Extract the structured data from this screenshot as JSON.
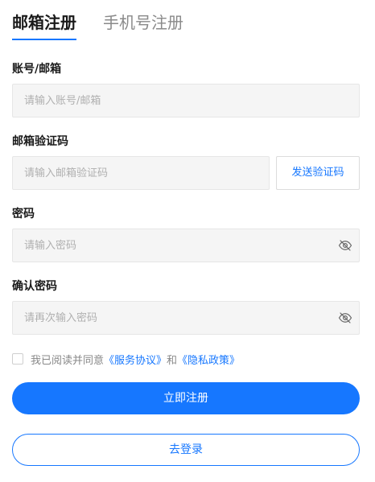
{
  "tabs": [
    {
      "label": "邮箱注册",
      "active": true
    },
    {
      "label": "手机号注册",
      "active": false
    }
  ],
  "form": {
    "account": {
      "label": "账号/邮箱",
      "placeholder": "请输入账号/邮箱",
      "value": ""
    },
    "email_code": {
      "label": "邮箱验证码",
      "placeholder": "请输入邮箱验证码",
      "value": "",
      "send_label": "发送验证码"
    },
    "password": {
      "label": "密码",
      "placeholder": "请输入密码",
      "value": "",
      "icon": "eye-off-icon"
    },
    "confirm_password": {
      "label": "确认密码",
      "placeholder": "请再次输入密码",
      "value": "",
      "icon": "eye-off-icon"
    }
  },
  "agreement": {
    "checked": false,
    "prefix": "我已阅读并同意",
    "service_link": "《服务协议》",
    "and": "和",
    "privacy_link": "《隐私政策》"
  },
  "actions": {
    "register_label": "立即注册",
    "login_label": "去登录"
  },
  "colors": {
    "accent": "#1677ff",
    "input_bg": "#f5f5f5",
    "placeholder": "#b0b0b0"
  }
}
